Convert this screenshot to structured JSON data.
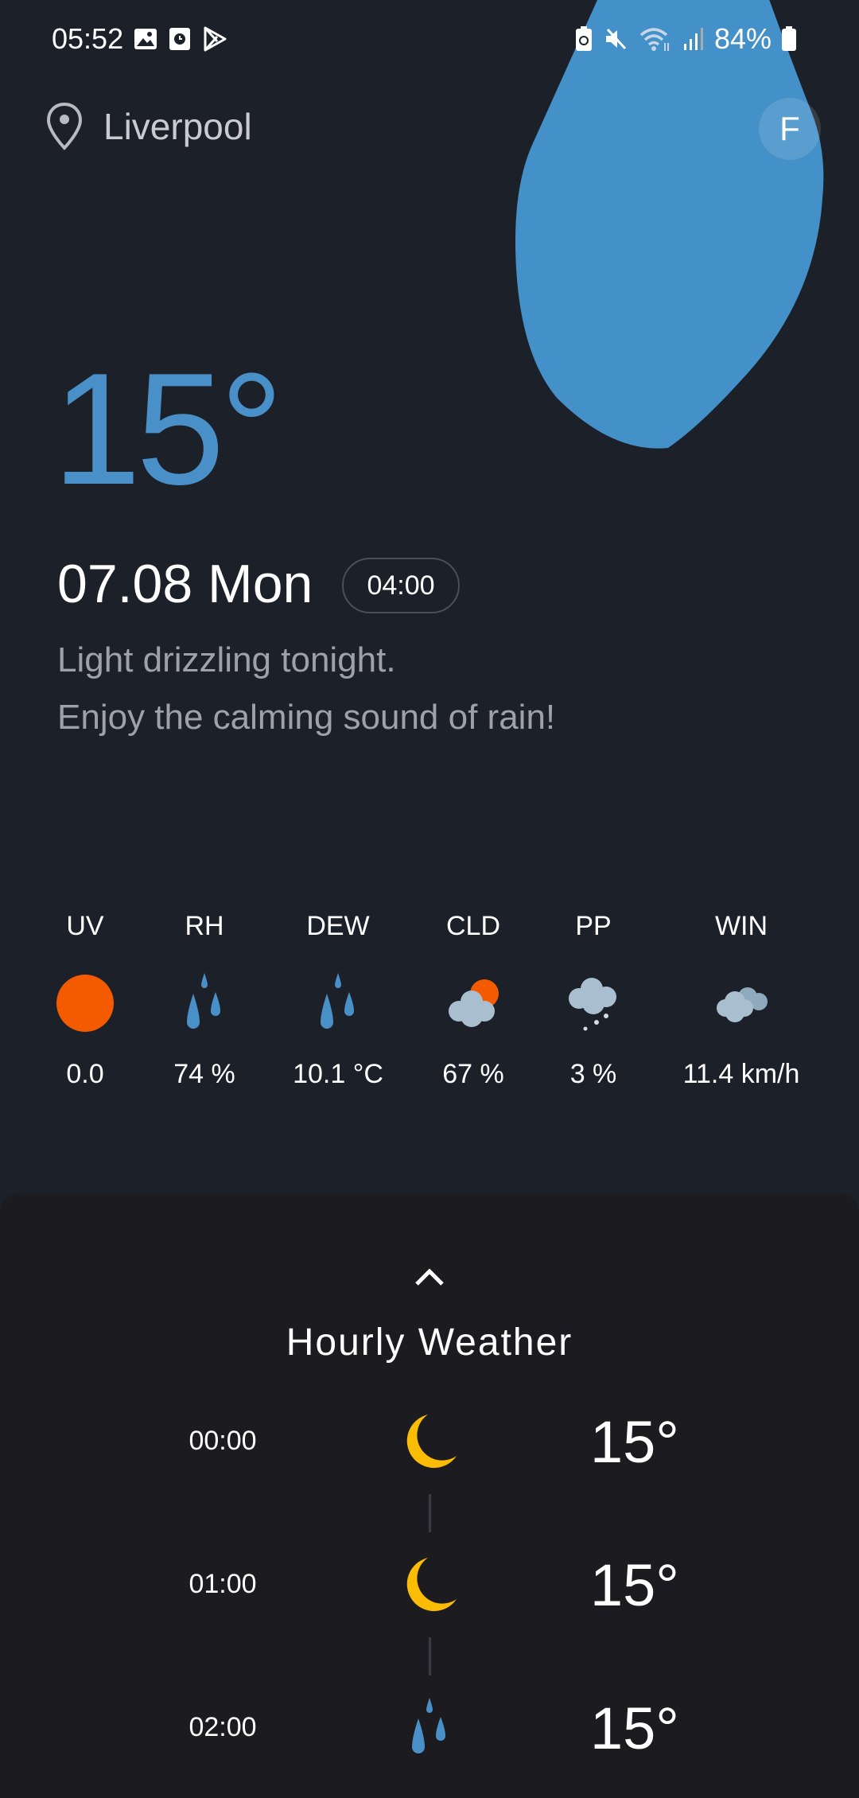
{
  "status_bar": {
    "time": "05:52",
    "battery": "84%",
    "icons": [
      "gallery-icon",
      "clock-icon",
      "play-store-icon",
      "battery-saver-icon",
      "mute-icon",
      "wifi-icon",
      "signal-icon",
      "battery-icon"
    ]
  },
  "header": {
    "location": "Liverpool",
    "avatar_letter": "F"
  },
  "current": {
    "temperature": "15°",
    "date": "07.08 Mon",
    "time": "04:00",
    "description_line1": "Light drizzling tonight.",
    "description_line2": "Enjoy the calming sound of rain!"
  },
  "metrics": [
    {
      "label": "UV",
      "value": "0.0",
      "icon": "sun-icon"
    },
    {
      "label": "RH",
      "value": "74 %",
      "icon": "raindrops-icon"
    },
    {
      "label": "DEW",
      "value": "10.1 °C",
      "icon": "raindrops-icon"
    },
    {
      "label": "CLD",
      "value": "67 %",
      "icon": "partly-cloudy-icon"
    },
    {
      "label": "PP",
      "value": "3 %",
      "icon": "cloud-snow-icon"
    },
    {
      "label": "WIN",
      "value": "11.4 km/h",
      "icon": "clouds-icon"
    }
  ],
  "hourly": {
    "title": "Hourly Weather",
    "rows": [
      {
        "time": "00:00",
        "icon": "moon-icon",
        "temp": "15°"
      },
      {
        "time": "01:00",
        "icon": "moon-icon",
        "temp": "15°"
      },
      {
        "time": "02:00",
        "icon": "raindrops-icon",
        "temp": "15°"
      }
    ]
  },
  "colors": {
    "background": "#1c2029",
    "accent": "#4a90c8",
    "sun": "#f45a00",
    "moon": "#fbbc05",
    "cloud": "#a9bfd0",
    "sheet": "#1c1c20"
  }
}
